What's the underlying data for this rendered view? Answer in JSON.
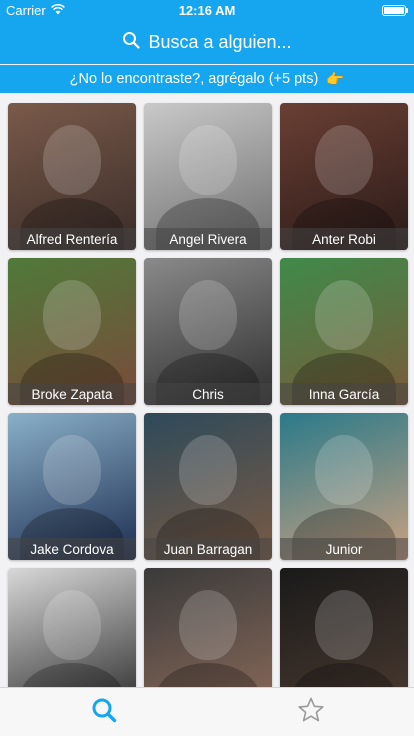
{
  "status_bar": {
    "carrier": "Carrier",
    "time": "12:16 AM"
  },
  "search": {
    "placeholder": "Busca a alguien...",
    "icon": "search-icon"
  },
  "banner": {
    "text": "¿No lo encontraste?, agrégalo (+5 pts)",
    "emoji": "👉"
  },
  "people": [
    {
      "name": "Alfred Rentería",
      "colors": [
        "#7a5a4a",
        "#3a2c28"
      ]
    },
    {
      "name": "Angel Rivera",
      "colors": [
        "#c9c9c9",
        "#6e6e6e"
      ]
    },
    {
      "name": "Anter Robi",
      "colors": [
        "#6a3f34",
        "#2a1a18"
      ]
    },
    {
      "name": "Broke Zapata",
      "colors": [
        "#4f7a3a",
        "#7a4a3a"
      ]
    },
    {
      "name": "Chris",
      "colors": [
        "#8a8a8a",
        "#2e2e2e"
      ]
    },
    {
      "name": "Inna García",
      "colors": [
        "#3f8a4a",
        "#7a5a3a"
      ]
    },
    {
      "name": "Jake Cordova",
      "colors": [
        "#8ab0c8",
        "#1e2e52"
      ]
    },
    {
      "name": "Juan Barragan",
      "colors": [
        "#2e4a5a",
        "#7a5a44"
      ]
    },
    {
      "name": "Junior",
      "colors": [
        "#2a7a8a",
        "#caa080"
      ]
    },
    {
      "name": "",
      "colors": [
        "#d8d8d8",
        "#2a2a2a"
      ]
    },
    {
      "name": "",
      "colors": [
        "#3a3a3a",
        "#8a6a5a"
      ]
    },
    {
      "name": "",
      "colors": [
        "#1a1a1a",
        "#4a3a30"
      ]
    }
  ],
  "tabs": [
    {
      "name": "search",
      "active": true,
      "color": "#16a6f0"
    },
    {
      "name": "favorites",
      "active": false,
      "color": "#9a9a9a"
    }
  ],
  "theme": {
    "primary": "#16a6f0"
  }
}
